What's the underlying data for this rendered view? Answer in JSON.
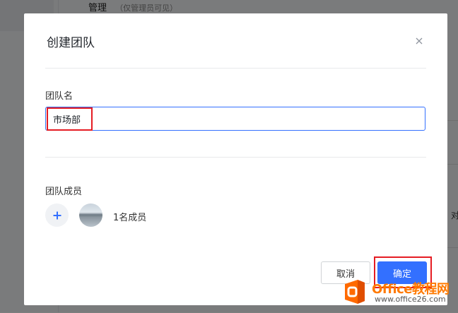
{
  "background": {
    "page_title": "管理",
    "page_hint": "（仅管理员可见）",
    "side_text": "对"
  },
  "dialog": {
    "title": "创建团队",
    "close_icon": "close-icon",
    "team_name_label": "团队名",
    "team_name_value": "市场部",
    "members_label": "团队成员",
    "add_icon": "plus-icon",
    "member_count": "1名成员",
    "cancel_label": "取消",
    "ok_label": "确定"
  },
  "colors": {
    "accent": "#3370ff",
    "highlight": "#e51c23"
  },
  "watermark": {
    "brand": "Office教程网",
    "url": "www.office26.com"
  }
}
